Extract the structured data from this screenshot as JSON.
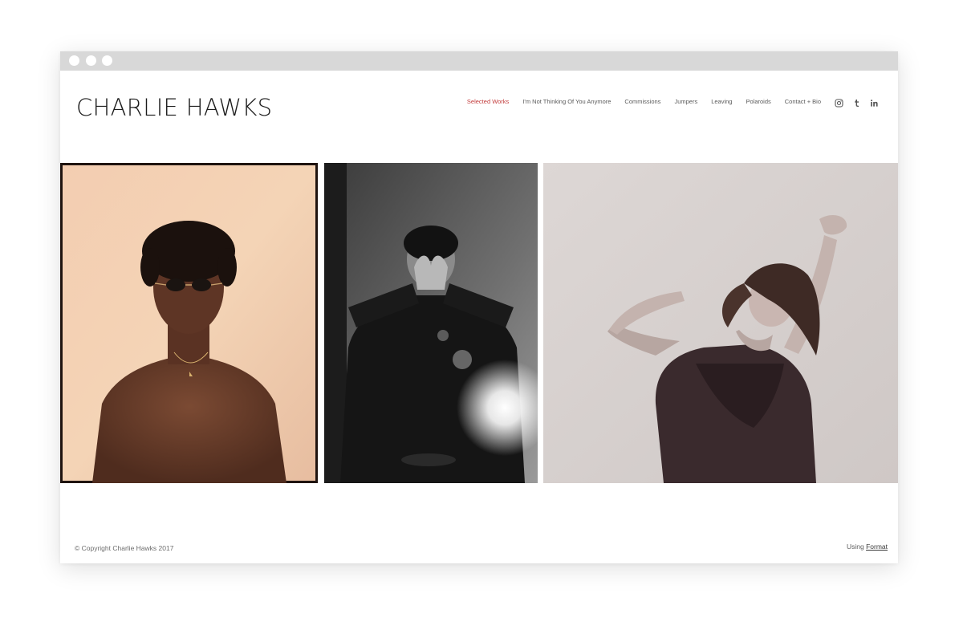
{
  "window": {
    "controls": [
      "close",
      "minimize",
      "maximize"
    ]
  },
  "site": {
    "title": "CHARLIE HAWKS"
  },
  "nav": {
    "items": [
      {
        "label": "Selected Works",
        "active": true
      },
      {
        "label": "I'm Not Thinking Of You Anymore",
        "active": false
      },
      {
        "label": "Commissions",
        "active": false
      },
      {
        "label": "Jumpers",
        "active": false
      },
      {
        "label": "Leaving",
        "active": false
      },
      {
        "label": "Polaroids",
        "active": false
      },
      {
        "label": "Contact + Bio",
        "active": false
      }
    ],
    "active_color": "#c23b3b",
    "text_color": "#5a5a5a"
  },
  "social": [
    {
      "icon": "instagram-icon"
    },
    {
      "icon": "tumblr-icon"
    },
    {
      "icon": "linkedin-icon"
    }
  ],
  "gallery": [
    {
      "name": "portrait-man-sunglasses-photo",
      "tone": "warm color"
    },
    {
      "name": "portrait-woman-hands-light-flare-photo",
      "tone": "black and white"
    },
    {
      "name": "portrait-woman-dancing-hair-photo",
      "tone": "sepia monochrome"
    }
  ],
  "footer": {
    "copyright": "© Copyright Charlie Hawks 2017",
    "using_prefix": "Using",
    "using_link": "Format"
  }
}
